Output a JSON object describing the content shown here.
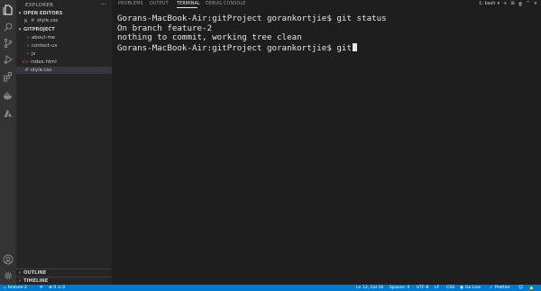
{
  "explorer": {
    "title": "EXPLORER",
    "more": "···",
    "open_editors": {
      "header": "OPEN EDITORS",
      "items": [
        {
          "close": "×",
          "file_icon": "#",
          "label": "style.css"
        }
      ]
    },
    "project": {
      "header": "GITPROJECT",
      "items": [
        {
          "type": "folder",
          "chevron": "›",
          "label": "about-me"
        },
        {
          "type": "folder",
          "chevron": "›",
          "label": "contact-us"
        },
        {
          "type": "folder",
          "chevron": "›",
          "label": "js"
        },
        {
          "type": "file",
          "file_icon": "<>",
          "label": "index.html"
        },
        {
          "type": "file",
          "file_icon": "#",
          "label": "style.css"
        }
      ]
    },
    "outline": "OUTLINE",
    "timeline": "TIMELINE"
  },
  "panel": {
    "tabs": [
      "PROBLEMS",
      "OUTPUT",
      "TERMINAL",
      "DEBUG CONSOLE"
    ],
    "active_tab": "TERMINAL",
    "shell_label": "1: bash",
    "add": "+",
    "split": "⊞",
    "trash": "🗑",
    "maximize": "^",
    "close": "×"
  },
  "terminal": {
    "lines": [
      "Gorans-MacBook-Air:gitProject gorankortjie$ git status",
      "On branch feature-2",
      "nothing to commit, working tree clean",
      "Gorans-MacBook-Air:gitProject gorankortjie$ git"
    ]
  },
  "statusbar": {
    "branch": "feature-2",
    "sync": "⟳",
    "problems": "⊗ 0 ⚠ 0",
    "position": "Ln 12, Col 16",
    "spaces": "Spaces: 4",
    "encoding": "UTF-8",
    "eol": "LF",
    "language": "CSS",
    "golive": "Go Live",
    "prettier": "Prettier",
    "feedback": "☺",
    "bell": "🔔"
  },
  "colors": {
    "activity_bar": "#333333",
    "sidebar": "#252526",
    "editor": "#1e1e1e",
    "status_bar": "#007acc"
  }
}
